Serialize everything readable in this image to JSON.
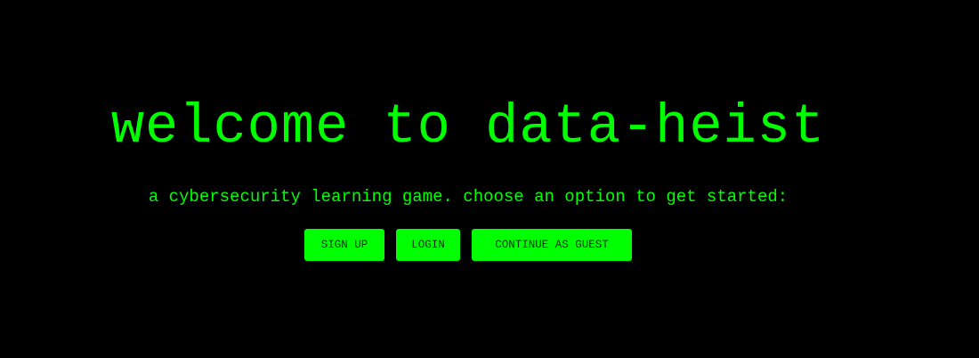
{
  "colors": {
    "background": "#000000",
    "accent": "#00ff00",
    "button_text": "#003300"
  },
  "hero": {
    "title": "welcome to data-heist",
    "subtitle": "a cybersecurity learning game. choose an option to get started:"
  },
  "actions": {
    "signup_label": "SIGN UP",
    "login_label": "LOGIN",
    "guest_label": "CONTINUE AS GUEST"
  }
}
